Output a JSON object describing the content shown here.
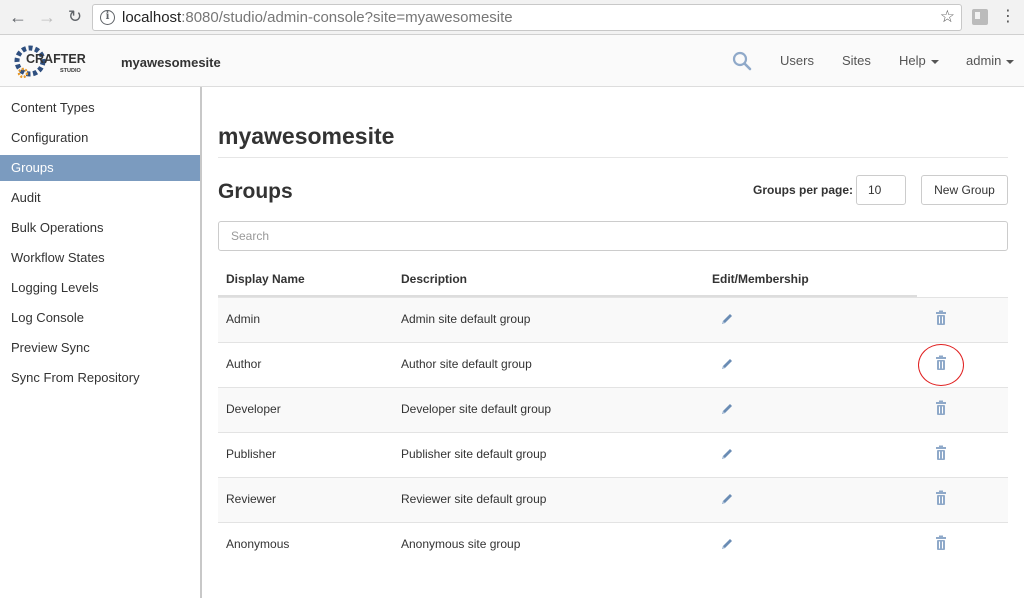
{
  "browser": {
    "url_host": "localhost",
    "url_rest": ":8080/studio/admin-console?site=myawesomesite"
  },
  "header": {
    "logo_text": "CRAFTER",
    "logo_sub": "STUDIO",
    "site_name": "myawesomesite",
    "links": {
      "users": "Users",
      "sites": "Sites",
      "help": "Help",
      "admin": "admin"
    }
  },
  "sidebar": {
    "items": [
      {
        "label": "Content Types"
      },
      {
        "label": "Configuration"
      },
      {
        "label": "Groups"
      },
      {
        "label": "Audit"
      },
      {
        "label": "Bulk Operations"
      },
      {
        "label": "Workflow States"
      },
      {
        "label": "Logging Levels"
      },
      {
        "label": "Log Console"
      },
      {
        "label": "Preview Sync"
      },
      {
        "label": "Sync From Repository"
      }
    ],
    "active": "Groups"
  },
  "main": {
    "site_title": "myawesomesite",
    "groups_title": "Groups",
    "per_page_label": "Groups per page:",
    "per_page_value": "10",
    "new_group_label": "New Group",
    "search_placeholder": "Search",
    "columns": {
      "display_name": "Display Name",
      "description": "Description",
      "edit": "Edit/Membership"
    },
    "rows": [
      {
        "name": "Admin",
        "description": "Admin site default group"
      },
      {
        "name": "Author",
        "description": "Author site default group"
      },
      {
        "name": "Developer",
        "description": "Developer site default group"
      },
      {
        "name": "Publisher",
        "description": "Publisher site default group"
      },
      {
        "name": "Reviewer",
        "description": "Reviewer site default group"
      },
      {
        "name": "Anonymous",
        "description": "Anonymous site group"
      }
    ]
  },
  "colors": {
    "active_sidebar": "#7b9bbf",
    "icon_blue": "#6a8cb4",
    "highlight": "#e02020"
  }
}
